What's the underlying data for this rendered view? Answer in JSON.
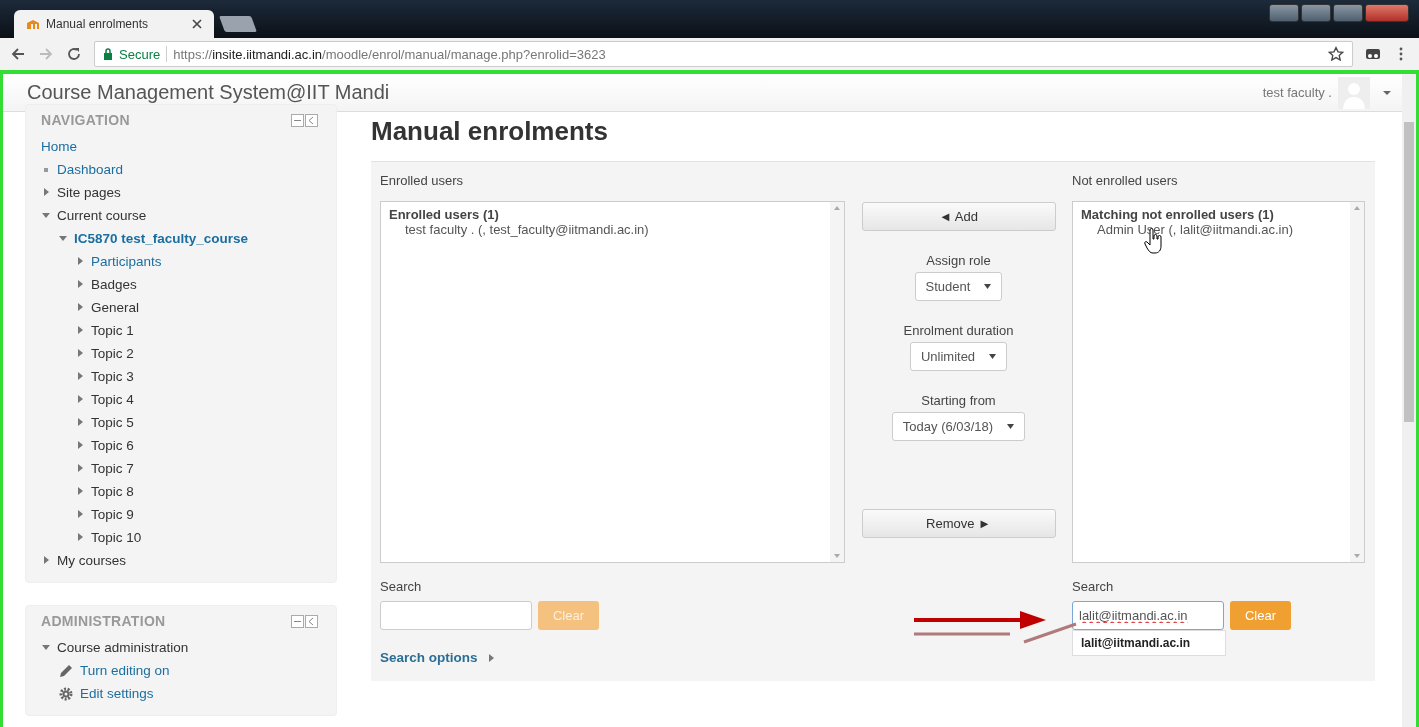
{
  "browser": {
    "tab": {
      "title": "Manual enrolments"
    },
    "secure_label": "Secure",
    "url": {
      "scheme": "https://",
      "host": "insite.iitmandi.ac.in",
      "path": "/moodle/enrol/manual/manage.php?enrolid=3623"
    }
  },
  "header": {
    "site_name": "Course Management System@IIT Mandi",
    "user_name": "test faculty ."
  },
  "navigation": {
    "title": "NAVIGATION",
    "items": [
      {
        "label": "Home",
        "kind": "plain",
        "link": true
      },
      {
        "label": "Dashboard",
        "kind": "bullet",
        "link": true
      },
      {
        "label": "Site pages",
        "kind": "branch",
        "expanded": false,
        "link": false
      },
      {
        "label": "Current course",
        "kind": "branch",
        "expanded": true,
        "link": false,
        "children": [
          {
            "label": "IC5870 test_faculty_course",
            "kind": "branch",
            "expanded": true,
            "current": true,
            "children": [
              {
                "label": "Participants",
                "kind": "branch",
                "expanded": false,
                "link": true
              },
              {
                "label": "Badges",
                "kind": "branch",
                "expanded": false,
                "link": false
              },
              {
                "label": "General",
                "kind": "branch",
                "expanded": false,
                "link": false
              },
              {
                "label": "Topic 1",
                "kind": "branch",
                "expanded": false,
                "link": false
              },
              {
                "label": "Topic 2",
                "kind": "branch",
                "expanded": false,
                "link": false
              },
              {
                "label": "Topic 3",
                "kind": "branch",
                "expanded": false,
                "link": false
              },
              {
                "label": "Topic 4",
                "kind": "branch",
                "expanded": false,
                "link": false
              },
              {
                "label": "Topic 5",
                "kind": "branch",
                "expanded": false,
                "link": false
              },
              {
                "label": "Topic 6",
                "kind": "branch",
                "expanded": false,
                "link": false
              },
              {
                "label": "Topic 7",
                "kind": "branch",
                "expanded": false,
                "link": false
              },
              {
                "label": "Topic 8",
                "kind": "branch",
                "expanded": false,
                "link": false
              },
              {
                "label": "Topic 9",
                "kind": "branch",
                "expanded": false,
                "link": false
              },
              {
                "label": "Topic 10",
                "kind": "branch",
                "expanded": false,
                "link": false
              }
            ]
          }
        ]
      },
      {
        "label": "My courses",
        "kind": "branch",
        "expanded": false,
        "link": false
      }
    ]
  },
  "administration": {
    "title": "ADMINISTRATION",
    "items": [
      {
        "label": "Course administration",
        "kind": "branch",
        "expanded": true,
        "link": false,
        "children": [
          {
            "label": "Turn editing on",
            "kind": "pencil",
            "link": true
          },
          {
            "label": "Edit settings",
            "kind": "gear",
            "link": true
          }
        ]
      }
    ]
  },
  "page_title": "Manual enrolments",
  "enrolled": {
    "label": "Enrolled users",
    "group": "Enrolled users (1)",
    "options": [
      "test faculty . (, test_faculty@iitmandi.ac.in)"
    ],
    "search_label": "Search",
    "clear": {
      "label": "Clear",
      "disabled": true
    },
    "search_options": "Search options"
  },
  "controls": {
    "add": "◄ Add",
    "remove": "Remove ►",
    "selects": [
      {
        "label": "Assign role",
        "value": "Student"
      },
      {
        "label": "Enrolment duration",
        "value": "Unlimited"
      },
      {
        "label": "Starting from",
        "value": "Today (6/03/18)"
      }
    ]
  },
  "not_enrolled": {
    "label": "Not enrolled users",
    "group": "Matching not enrolled users (1)",
    "options": [
      "Admin User (, lalit@iitmandi.ac.in)"
    ],
    "search_label": "Search",
    "search_value": "lalit@iitmandi.ac.in",
    "clear": {
      "label": "Clear",
      "disabled": false
    },
    "suggestion": "lalit@iitmandi.ac.in"
  }
}
